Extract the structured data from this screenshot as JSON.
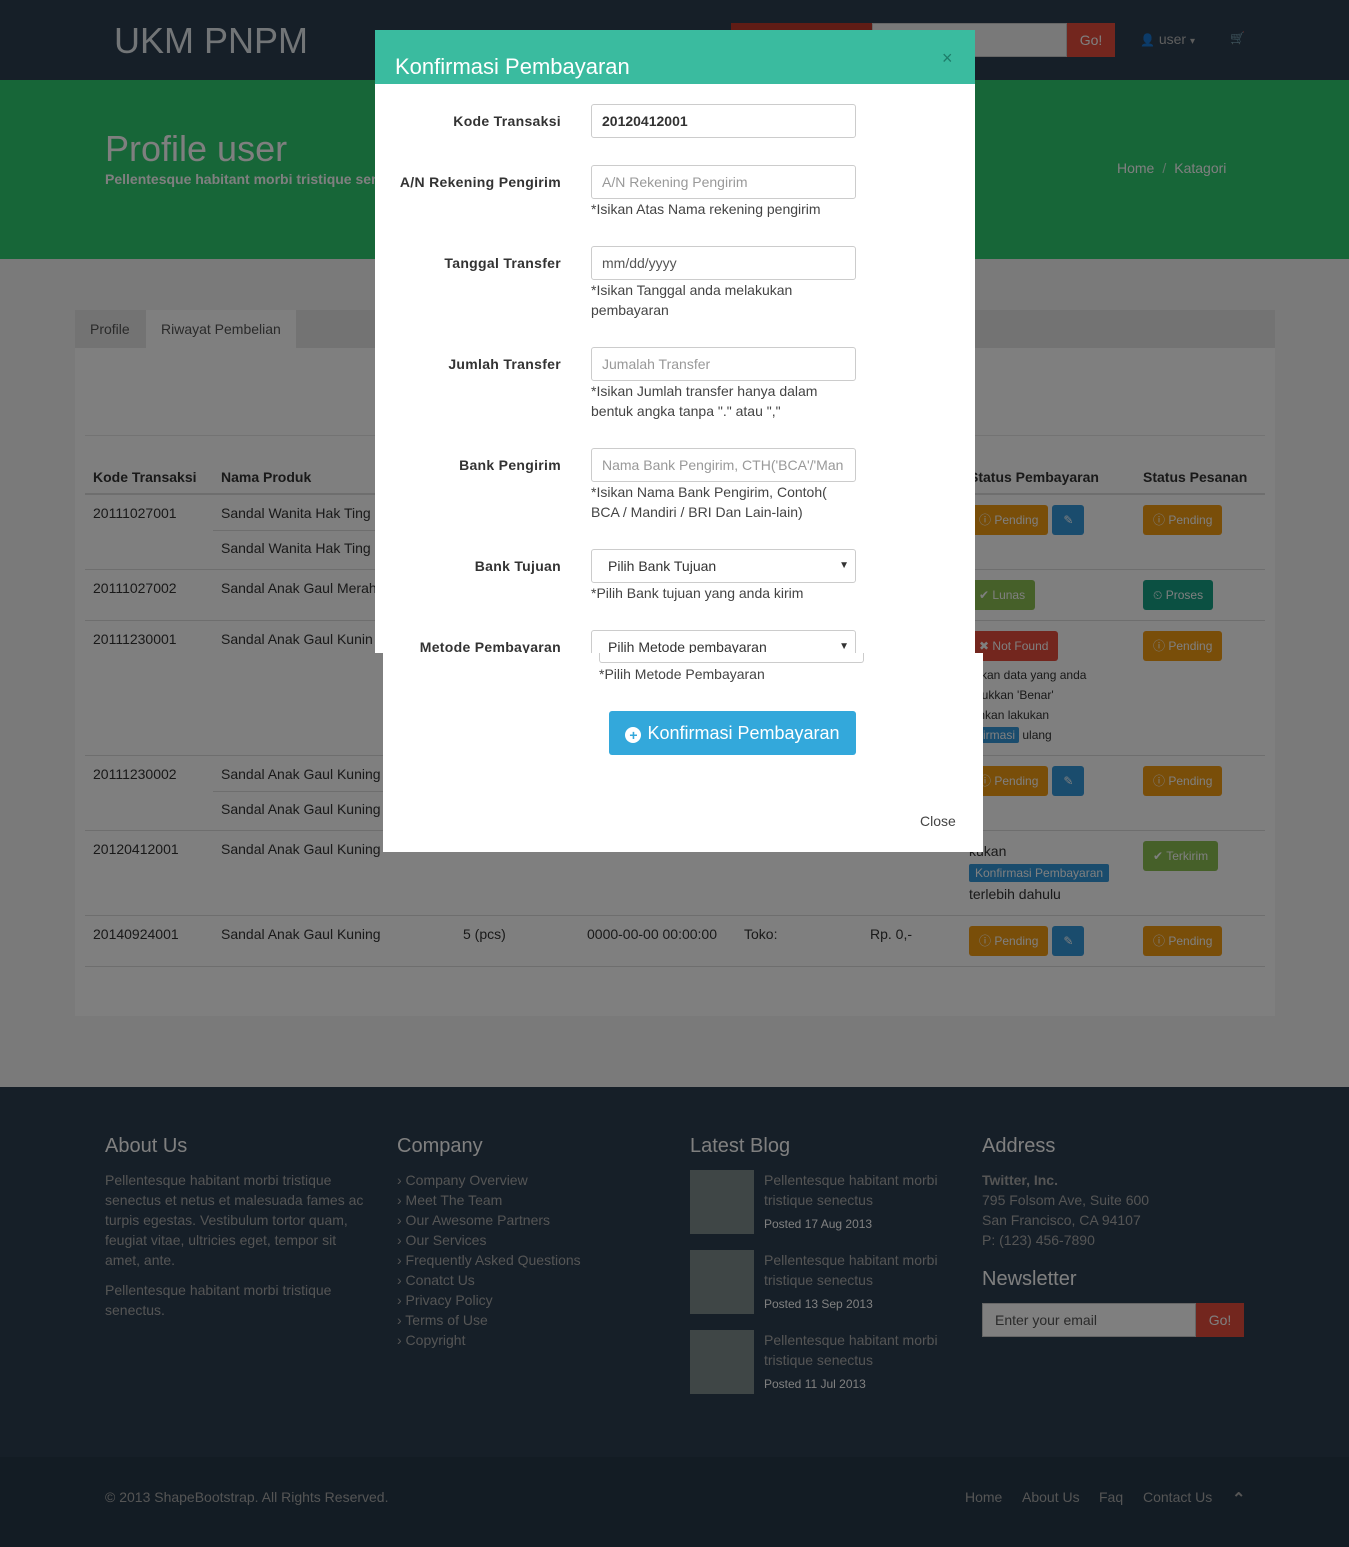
{
  "nav": {
    "logo": "UKM PNPM",
    "go_label": "Go!",
    "user_label": "user",
    "caret": "▾",
    "cart_icon": "🛒",
    "user_icon": "👤"
  },
  "header": {
    "title": "Profile user",
    "subtitle": "Pellentesque habitant morbi tristique senec",
    "breadcrumb": [
      "Home",
      "Katagori"
    ],
    "sep": "/"
  },
  "tabs": [
    "Profile",
    "Riwayat Pembelian"
  ],
  "table": {
    "headers": [
      "Kode Transaksi",
      "Nama Produk",
      "",
      "",
      "",
      "",
      "Status Pembayaran",
      "Status Pesanan"
    ],
    "rows": [
      {
        "kode": "20111027001",
        "produk": [
          "Sandal Wanita Hak Ting",
          "Sandal Wanita Hak Ting"
        ],
        "bayar": "Pending",
        "pesanan": "Pending"
      },
      {
        "kode": "20111027002",
        "produk": [
          "Sandal Anak Gaul Merah"
        ],
        "bayar": "Lunas",
        "pesanan": "Proses"
      },
      {
        "kode": "20111230001",
        "produk": [
          "Sandal Anak Gaul Kunin"
        ],
        "bayar": "Not Found",
        "note": [
          "stikan data yang anda",
          "asukkan 'Benar'",
          "lahkan lakukan"
        ],
        "note_btn": "nfirmasi",
        "note_end": "ulang",
        "pesanan": "Pending"
      },
      {
        "kode": "20111230002",
        "produk": [
          "Sandal Anak Gaul Kuning",
          "Sandal Anak Gaul Kuning"
        ],
        "bayar": "Pending",
        "pesanan": "Pending"
      },
      {
        "kode": "20120412001",
        "produk": [
          "Sandal Anak Gaul Kuning"
        ],
        "bayar_note_start": "kukan",
        "bayar_note_btn": "Konfirmasi Pembayaran",
        "bayar_note_end": "terlebih dahulu",
        "pesanan": "Terkirim"
      },
      {
        "kode": "20140924001",
        "produk": [
          "Sandal Anak Gaul Kuning"
        ],
        "qty": "5 (pcs)",
        "tanggal": "0000-00-00 00:00:00",
        "toko": "Toko:",
        "harga": "Rp. 0,-",
        "bayar": "Pending",
        "pesanan": "Pending"
      }
    ]
  },
  "modal": {
    "title": "Konfirmasi Pembayaran",
    "close_x": "×",
    "fields": [
      {
        "label": "Kode Transaksi",
        "value": "20120412001"
      },
      {
        "label": "A/N Rekening Pengirim",
        "placeholder": "A/N Rekening Pengirim",
        "help": "*Isikan Atas Nama rekening pengirim"
      },
      {
        "label": "Tanggal Transfer",
        "placeholder": "mm/dd/yyyy",
        "help": "*Isikan Tanggal anda melakukan pembayaran"
      },
      {
        "label": "Jumlah Transfer",
        "placeholder": "Jumalah Transfer",
        "help": "*Isikan Jumlah transfer hanya dalam bentuk angka tanpa \".\" atau \",\""
      },
      {
        "label": "Bank Pengirim",
        "placeholder": "Nama Bank Pengirim, CTH('BCA'/'Man",
        "help": "*Isikan Nama Bank Pengirim, Contoh( BCA / Mandiri / BRI Dan Lain-lain)"
      },
      {
        "label": "Bank Tujuan",
        "selected": "Pilih Bank Tujuan",
        "help": "*Pilih Bank tujuan yang anda kirim"
      },
      {
        "label": "Metode Pembayaran",
        "selected": "Pilih Metode pembayaran",
        "help": "*Pilih Metode Pembayaran"
      }
    ],
    "submit_label": "Konfirmasi Pembayaran",
    "submit_icon": "+",
    "close_label": "Close",
    "select_caret": "▼"
  },
  "footer": {
    "about": {
      "title": "About Us",
      "p1": "Pellentesque habitant morbi tristique senectus et netus et malesuada fames ac turpis egestas. Vestibulum tortor quam, feugiat vitae, ultricies eget, tempor sit amet, ante.",
      "p2": "Pellentesque habitant morbi tristique senectus."
    },
    "company": {
      "title": "Company",
      "links": [
        "› Company Overview",
        "› Meet The Team",
        "› Our Awesome Partners",
        "› Our Services",
        "› Frequently Asked Questions",
        "› Conatct Us",
        "› Privacy Policy",
        "› Terms of Use",
        "› Copyright"
      ]
    },
    "blog": {
      "title": "Latest Blog",
      "posts": [
        {
          "text": "Pellentesque habitant morbi tristique senectus",
          "date": "Posted 17 Aug 2013"
        },
        {
          "text": "Pellentesque habitant morbi tristique senectus",
          "date": "Posted 13 Sep 2013"
        },
        {
          "text": "Pellentesque habitant morbi tristique senectus",
          "date": "Posted 11 Jul 2013"
        }
      ]
    },
    "address": {
      "title": "Address",
      "company": "Twitter, Inc.",
      "line1": "795 Folsom Ave, Suite 600",
      "line2": "San Francisco, CA 94107",
      "phone": "P: (123) 456-7890",
      "newsletter_title": "Newsletter",
      "email_placeholder": "Enter your email",
      "go_label": "Go!"
    },
    "copyright": "© 2013 ShapeBootstrap. All Rights Reserved.",
    "nav": [
      "Home",
      "About Us",
      "Faq",
      "Contact Us"
    ],
    "up_icon": "⌃"
  }
}
